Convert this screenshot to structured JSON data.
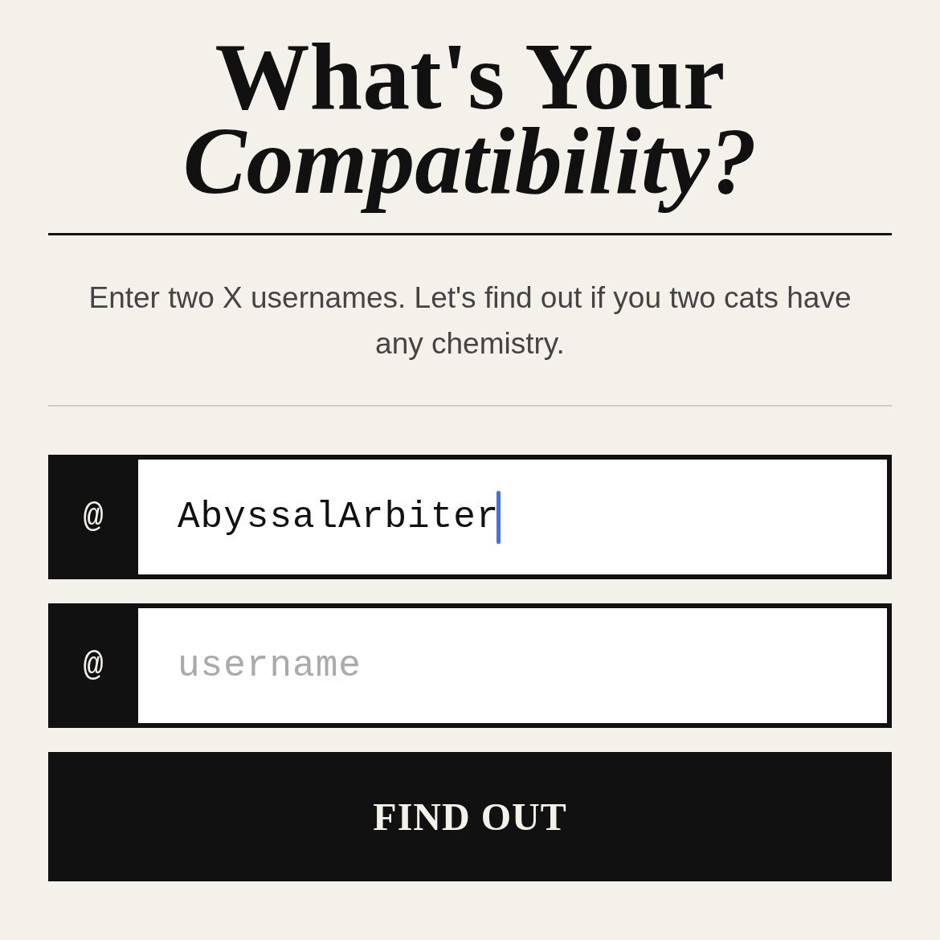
{
  "heading": {
    "title": "What's Your *Compatibility?*"
  },
  "intro": {
    "text": "Enter two X usernames. Let's find out if you two cats have any chemistry."
  },
  "fields": [
    {
      "prefix": "@",
      "value": "AbyssalArbiter",
      "focused": true
    },
    {
      "prefix": "@",
      "placeholder": "username",
      "focused": false
    }
  ],
  "button": {
    "label": "FIND OUT"
  }
}
